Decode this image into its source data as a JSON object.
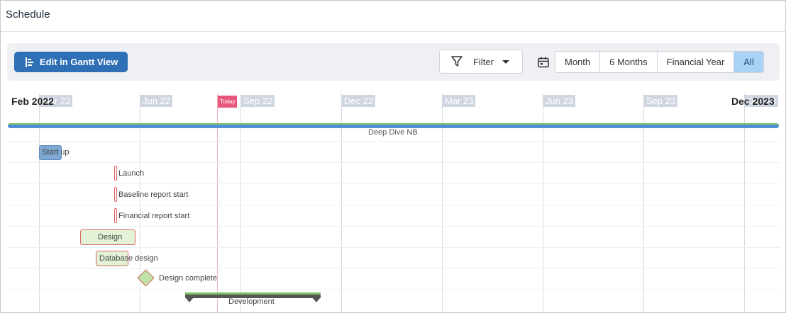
{
  "header": {
    "title": "Schedule"
  },
  "toolbar": {
    "edit_label": "Edit in Gantt View",
    "filter_label": "Filter",
    "ranges": [
      {
        "label": "Month",
        "active": false
      },
      {
        "label": "6 Months",
        "active": false
      },
      {
        "label": "Financial Year",
        "active": false
      },
      {
        "label": "All",
        "active": true
      }
    ]
  },
  "timeline": {
    "start_label": "Feb 2022",
    "end_label": "Dec 2023",
    "today_label": "Today",
    "ticks": [
      "Mar 22",
      "Jun 22",
      "Sep 22",
      "Dec 22",
      "Mar 23",
      "Jun 23",
      "Sep 23",
      "Dec 23"
    ]
  },
  "tasks": {
    "project": "Deep Dive NB",
    "startup": "Start up",
    "launch": "Launch",
    "baseline": "Baseline report start",
    "financial": "Financial report start",
    "design": "Design",
    "database": "Database design",
    "design_complete": "Design complete",
    "development": "Development"
  },
  "colors": {
    "primary_button": "#2f6fb5",
    "active_range": "#a9d2f5",
    "today": "#e8567d",
    "project_bar": "#4f8fd8",
    "progress_green": "#82c063"
  }
}
